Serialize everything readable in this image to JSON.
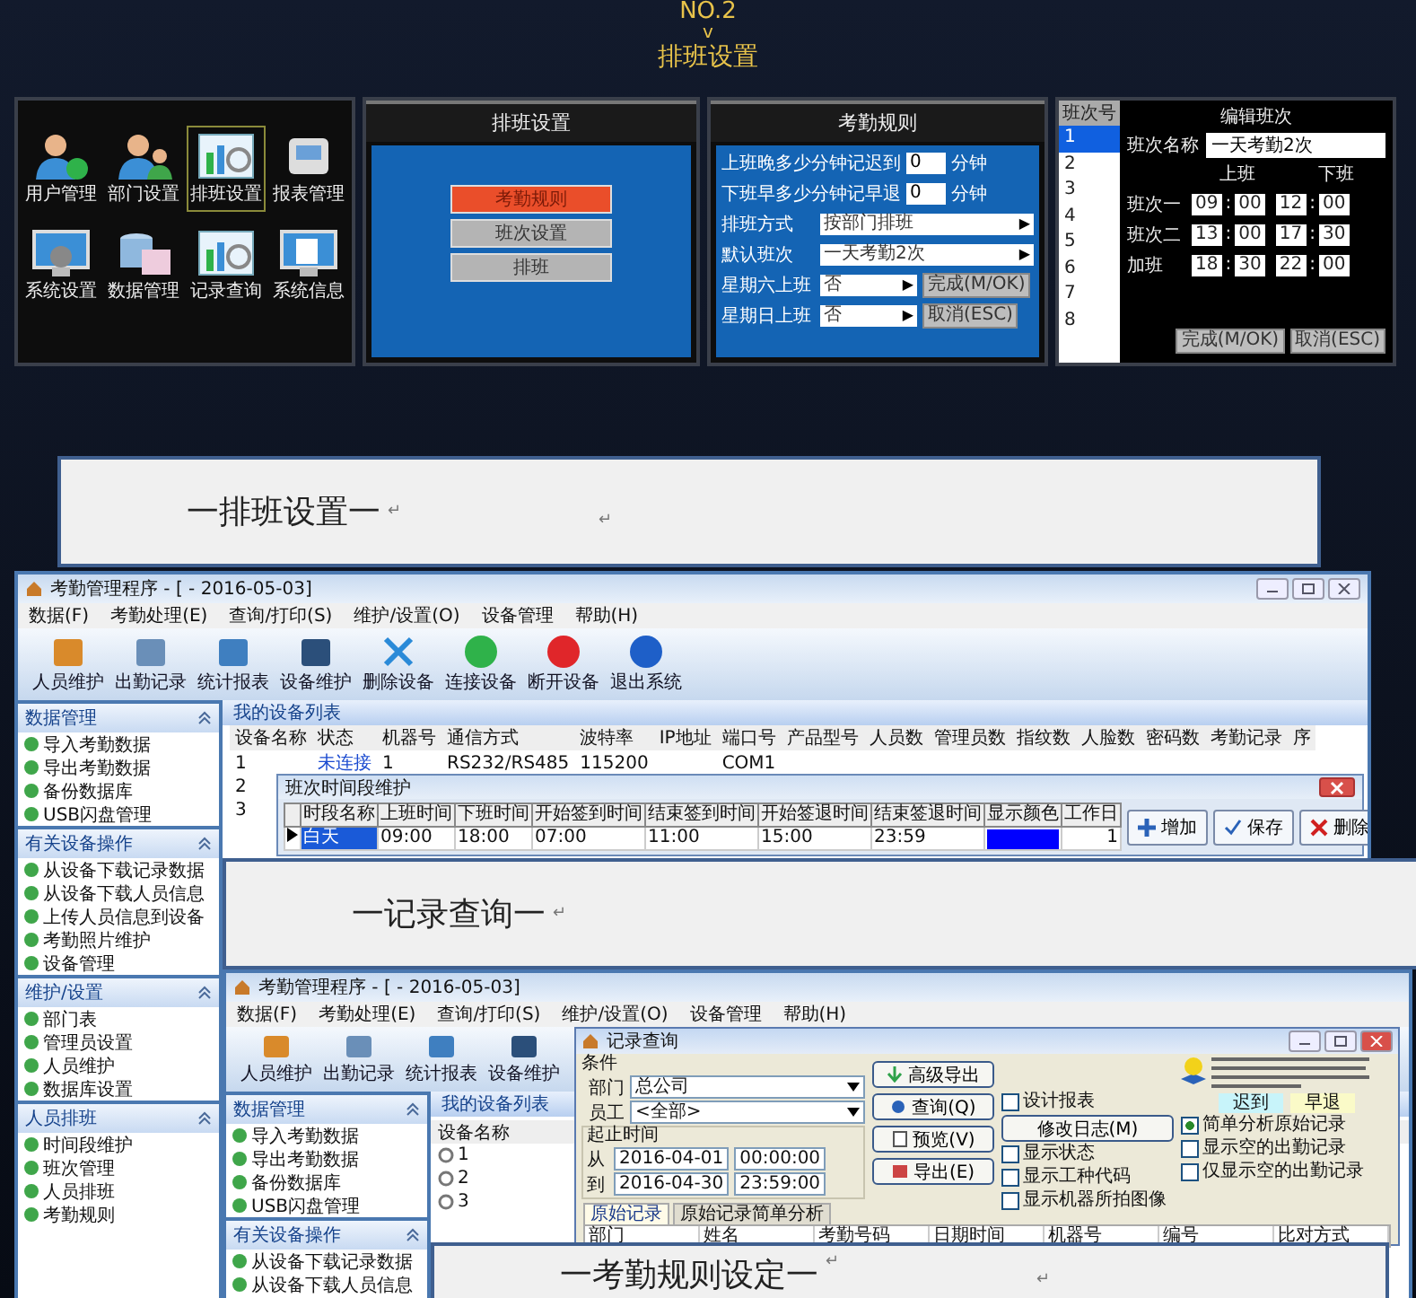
{
  "header": {
    "number": "NO.2",
    "arrow": "v",
    "title": "排班设置"
  },
  "main_menu": {
    "items": [
      {
        "label": "用户管理",
        "selected": false
      },
      {
        "label": "部门设置",
        "selected": false
      },
      {
        "label": "排班设置",
        "selected": true
      },
      {
        "label": "报表管理",
        "selected": false
      },
      {
        "label": "系统设置",
        "selected": false
      },
      {
        "label": "数据管理",
        "selected": false
      },
      {
        "label": "记录查询",
        "selected": false
      },
      {
        "label": "系统信息",
        "selected": false
      }
    ]
  },
  "schedule_menu": {
    "title": "排班设置",
    "options": [
      {
        "label": "考勤规则",
        "selected": true
      },
      {
        "label": "班次设置",
        "selected": false
      },
      {
        "label": "排班",
        "selected": false
      }
    ]
  },
  "rules_panel": {
    "title": "考勤规则",
    "rows": [
      {
        "kind": "input",
        "label": "上班晚多少分钟记迟到",
        "value": "0",
        "unit": "分钟"
      },
      {
        "kind": "input",
        "label": "下班早多少分钟记早退",
        "value": "0",
        "unit": "分钟"
      },
      {
        "kind": "select",
        "label": "排班方式",
        "value": "按部门排班",
        "arrow": "▶"
      },
      {
        "kind": "select",
        "label": "默认班次",
        "value": "一天考勤2次",
        "arrow": "▶"
      },
      {
        "kind": "select",
        "label": "星期六上班",
        "value": "否",
        "arrow": "▶",
        "button": "完成(M/OK)"
      },
      {
        "kind": "select",
        "label": "星期日上班",
        "value": "否",
        "arrow": "▶",
        "button": "取消(ESC)"
      }
    ]
  },
  "shift_panel": {
    "list_header": "班次号",
    "numbers": [
      {
        "label": "1",
        "selected": true
      },
      {
        "label": "2",
        "selected": false
      },
      {
        "label": "3",
        "selected": false
      },
      {
        "label": "4",
        "selected": false
      },
      {
        "label": "5",
        "selected": false
      },
      {
        "label": "6",
        "selected": false
      },
      {
        "label": "7",
        "selected": false
      },
      {
        "label": "8",
        "selected": false
      }
    ],
    "title": "编辑班次",
    "name_label": "班次名称",
    "name_value": "一天考勤2次",
    "on_header": "上班",
    "off_header": "下班",
    "shifts": [
      {
        "label": "班次一",
        "on_hour": "09",
        "on_colon": ":",
        "on_min": "00",
        "off_hour": "12",
        "off_colon": ":",
        "off_min": "00"
      },
      {
        "label": "班次二",
        "on_hour": "13",
        "on_colon": ":",
        "on_min": "00",
        "off_hour": "17",
        "off_colon": ":",
        "off_min": "30"
      },
      {
        "label": "加班",
        "on_hour": "18",
        "on_colon": ":",
        "on_min": "30",
        "off_hour": "22",
        "off_colon": ":",
        "off_min": "00"
      }
    ],
    "buttons": [
      "完成(M/OK)",
      "取消(ESC)"
    ]
  },
  "banners": [
    {
      "title": "一排班设置一",
      "marks": [
        "↵",
        "↵"
      ]
    },
    {
      "title": "一记录查询一",
      "marks": [
        "↵"
      ]
    },
    {
      "title": "一考勤规则设定一",
      "marks": [
        "↵",
        "↵"
      ]
    }
  ],
  "window1": {
    "title": "考勤管理程序 - [ - 2016-05-03]",
    "menu": [
      "数据(F)",
      "考勤处理(E)",
      "查询/打印(S)",
      "维护/设置(O)",
      "设备管理",
      "帮助(H)"
    ],
    "toolbar": [
      "人员维护",
      "出勤记录",
      "统计报表",
      "设备维护",
      "删除设备",
      "连接设备",
      "断开设备",
      "退出系统"
    ],
    "sidebar": [
      {
        "title": "数据管理",
        "items": [
          "导入考勤数据",
          "导出考勤数据",
          "备份数据库",
          "USB闪盘管理"
        ]
      },
      {
        "title": "有关设备操作",
        "items": [
          "从设备下载记录数据",
          "从设备下载人员信息",
          "上传人员信息到设备",
          "考勤照片维护",
          "设备管理"
        ]
      },
      {
        "title": "维护/设置",
        "items": [
          "部门表",
          "管理员设置",
          "人员维护",
          "数据库设置"
        ]
      },
      {
        "title": "人员排班",
        "items": [
          "时间段维护",
          "班次管理",
          "人员排班",
          "考勤规则"
        ]
      }
    ],
    "list_title": "我的设备列表",
    "columns": [
      "设备名称",
      "状态",
      "机器号",
      "通信方式",
      "波特率",
      "IP地址",
      "端口号",
      "产品型号",
      "人员数",
      "管理员数",
      "指纹数",
      "人脸数",
      "密码数",
      "考勤记录",
      "序"
    ],
    "rows": [
      {
        "name": "1",
        "status": "未连接",
        "machine_no": "1",
        "comm": "RS232/RS485",
        "baud": "115200",
        "port": "COM1"
      },
      {
        "name": "2"
      },
      {
        "name": "3"
      }
    ]
  },
  "shift_dialog": {
    "title": "班次时间段维护",
    "columns": [
      "时段名称",
      "上班时间",
      "下班时间",
      "开始签到时间",
      "结束签到时间",
      "开始签退时间",
      "结束签退时间",
      "显示颜色",
      "工作日"
    ],
    "row": {
      "cells": [
        "白天",
        "09:00",
        "18:00",
        "07:00",
        "11:00",
        "15:00",
        "23:59"
      ],
      "color": "#0000ff",
      "workday": "1"
    },
    "buttons": [
      {
        "kind": "add",
        "label": "增加"
      },
      {
        "kind": "save",
        "label": "保存"
      },
      {
        "kind": "delete",
        "label": "删除"
      }
    ]
  },
  "window2": {
    "title": "考勤管理程序 - [ - 2016-05-03]",
    "menu": [
      "数据(F)",
      "考勤处理(E)",
      "查询/打印(S)",
      "维护/设置(O)",
      "设备管理",
      "帮助(H)"
    ],
    "toolbar": [
      "人员维护",
      "出勤记录",
      "统计报表",
      "设备维护"
    ],
    "sidebar": [
      {
        "title": "数据管理",
        "items": [
          "导入考勤数据",
          "导出考勤数据",
          "备份数据库",
          "USB闪盘管理"
        ]
      },
      {
        "title": "有关设备操作",
        "items": [
          "从设备下载记录数据",
          "从设备下载人员信息"
        ]
      }
    ],
    "list_title": "我的设备列表",
    "column": "设备名称",
    "rows": [
      "1",
      "2",
      "3"
    ]
  },
  "record_query": {
    "title": "记录查询",
    "conditions_label": "条件",
    "dept_label": "部门",
    "dept_value": "总公司",
    "employee_label": "员工",
    "employee_value": "<全部>",
    "range_label": "起止时间",
    "from_label": "从",
    "from_date": "2016-04-01",
    "from_time": "00:00:00",
    "to_label": "到",
    "to_date": "2016-04-30",
    "to_time": "23:59:00",
    "buttons": [
      {
        "kind": "advanced",
        "label": "高级导出"
      },
      {
        "kind": "query",
        "label": "查询(Q)"
      },
      {
        "kind": "preview",
        "label": "预览(V)"
      },
      {
        "kind": "export",
        "label": "导出(E)"
      }
    ],
    "design_report": {
      "label": "设计报表",
      "checked": false
    },
    "log_button": "修改日志(M)",
    "options_left": [
      {
        "label": "显示状态",
        "checked": false
      },
      {
        "label": "显示工种代码",
        "checked": false
      },
      {
        "label": "显示机器所拍图像",
        "checked": false
      }
    ],
    "legend": [
      {
        "label": "迟到",
        "color": "#c8f4fa"
      },
      {
        "label": "早退",
        "color": "#fafac8"
      }
    ],
    "options_right": [
      {
        "label": "简单分析原始记录",
        "checked": true
      },
      {
        "label": "显示空的出勤记录",
        "checked": false
      },
      {
        "label": "仅显示空的出勤记录",
        "checked": false
      }
    ],
    "tabs": [
      {
        "label": "原始记录",
        "selected": true
      },
      {
        "label": "原始记录简单分析",
        "selected": false
      }
    ],
    "columns": [
      "部门",
      "姓名",
      "考勤号码",
      "日期时间",
      "机器号",
      "编号",
      "比对方式"
    ]
  }
}
